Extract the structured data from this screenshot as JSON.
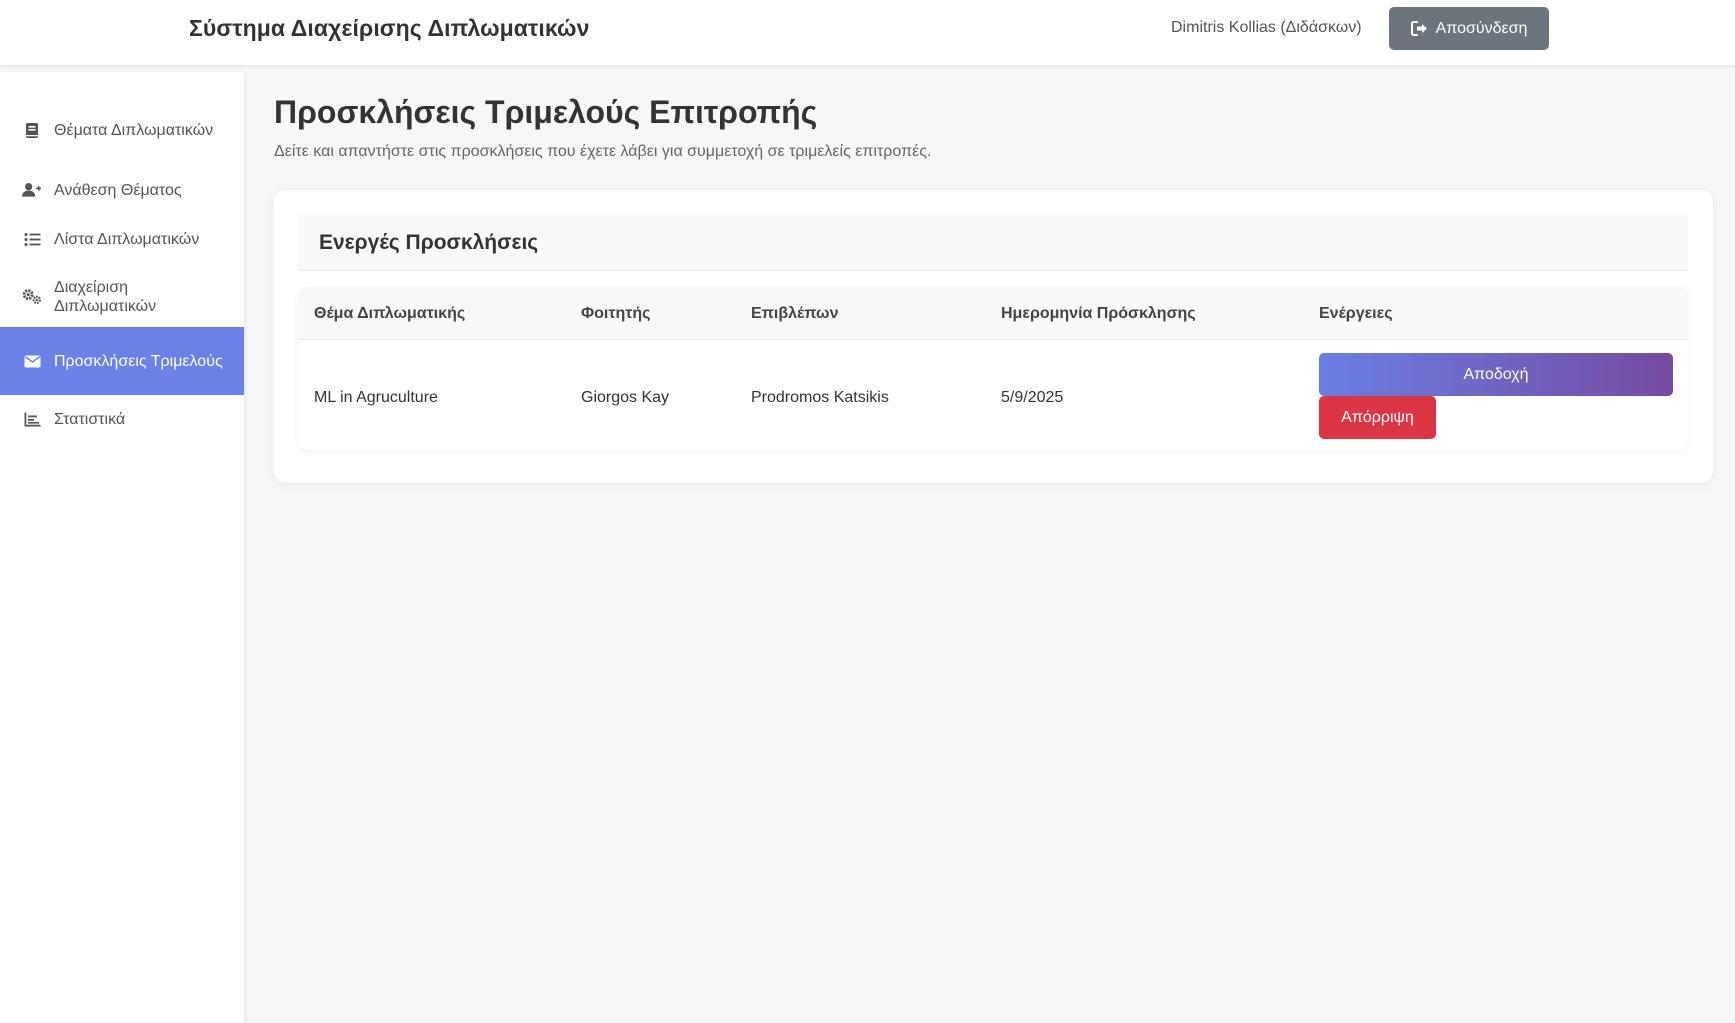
{
  "header": {
    "app_title": "Σύστημα Διαχείρισης Διπλωματικών",
    "user": "Dimitris Kollias (Διδάσκων)",
    "logout_label": "Αποσύνδεση",
    "logout_icon": "sign-out-icon",
    "logout_color": "#6c757d"
  },
  "sidebar": {
    "active_color": "#6a82e8",
    "items": [
      {
        "label": "Θέματα Διπλωματικών",
        "icon": "book-icon",
        "active": false
      },
      {
        "label": "Ανάθεση Θέματος",
        "icon": "user-plus-icon",
        "active": false
      },
      {
        "label": "Λίστα Διπλωματικών",
        "icon": "list-icon",
        "active": false
      },
      {
        "label": "Διαχείριση Διπλωματικών",
        "icon": "gears-icon",
        "active": false
      },
      {
        "label": "Προσκλήσεις Τριμελούς",
        "icon": "envelope-icon",
        "active": true
      },
      {
        "label": "Στατιστικά",
        "icon": "chart-bar-icon",
        "active": false
      }
    ]
  },
  "main": {
    "title": "Προσκλήσεις Τριμελούς Επιτροπής",
    "subtitle": "Δείτε και απαντήστε στις προσκλήσεις που έχετε λάβει για συμμετοχή σε τριμελείς επιτροπές.",
    "card": {
      "title": "Ενεργές Προσκλήσεις",
      "columns": [
        "Θέμα Διπλωματικής",
        "Φοιτητής",
        "Επιβλέπων",
        "Ημερομηνία Πρόσκλησης",
        "Ενέργειες"
      ],
      "rows": [
        {
          "topic": "ML in Agruculture",
          "student": "Giorgos Kay",
          "supervisor": "Prodromos Katsikis",
          "date": "5/9/2025",
          "accept_label": "Αποδοχή",
          "reject_label": "Απόρριψη"
        }
      ]
    }
  },
  "colors": {
    "accept_gradient_start": "#6a7fe4",
    "accept_gradient_end": "#764ba2",
    "reject": "#dc3545"
  }
}
